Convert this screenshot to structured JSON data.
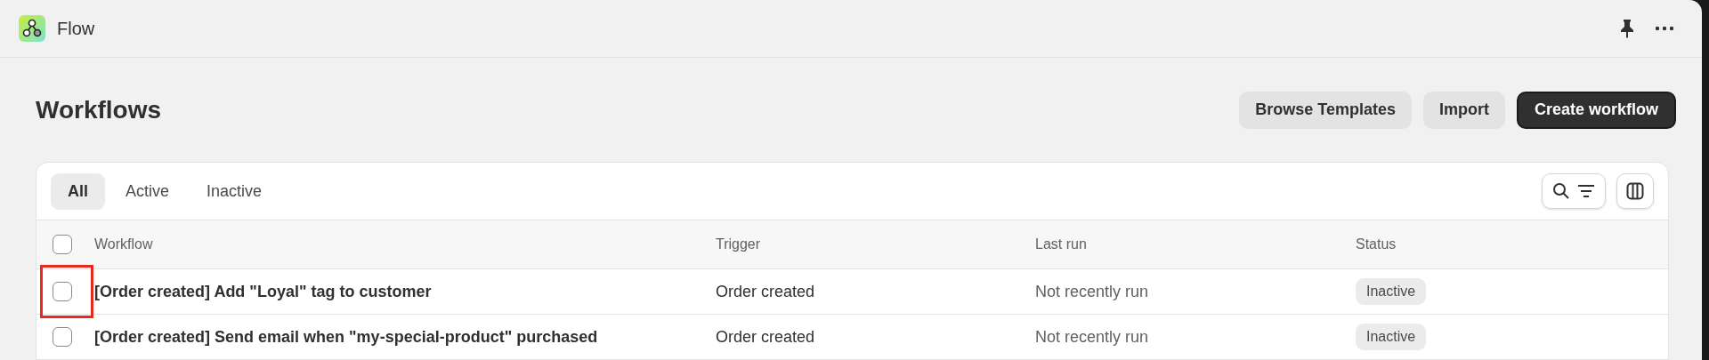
{
  "app": {
    "title": "Flow"
  },
  "page": {
    "title": "Workflows",
    "buttons": [
      {
        "label": "Browse Templates",
        "kind": "secondary"
      },
      {
        "label": "Import",
        "kind": "secondary"
      },
      {
        "label": "Create workflow",
        "kind": "primary"
      }
    ]
  },
  "tabs": [
    {
      "label": "All",
      "selected": true
    },
    {
      "label": "Active",
      "selected": false
    },
    {
      "label": "Inactive",
      "selected": false
    }
  ],
  "table": {
    "select_all": {
      "checked": false
    },
    "columns": [
      "Workflow",
      "Trigger",
      "Last run",
      "Status"
    ],
    "rows": [
      {
        "checked": false,
        "highlighted": true,
        "workflow": "[Order created] Add \"Loyal\" tag to customer",
        "trigger": "Order created",
        "last_run": "Not recently run",
        "status": "Inactive"
      },
      {
        "checked": false,
        "highlighted": false,
        "workflow": "[Order created] Send email when \"my-special-product\" purchased",
        "trigger": "Order created",
        "last_run": "Not recently run",
        "status": "Inactive"
      }
    ]
  }
}
